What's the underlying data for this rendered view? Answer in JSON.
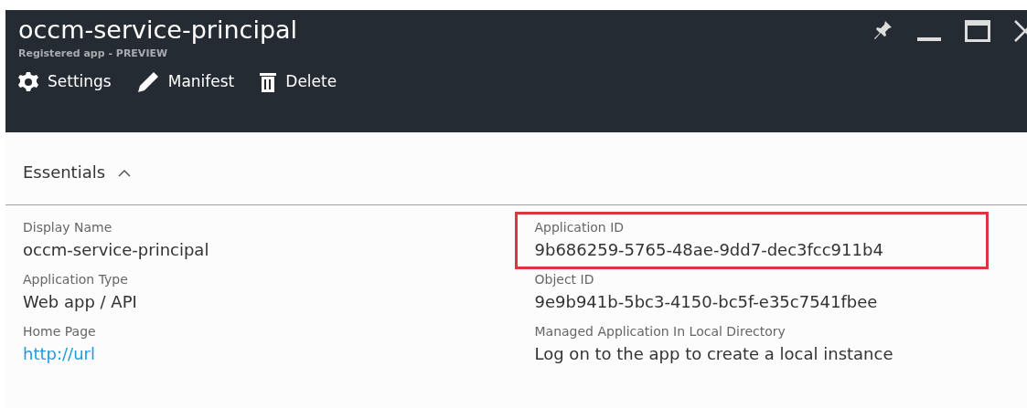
{
  "blade": {
    "title": "occm-service-principal",
    "subtitle": "Registered app - PREVIEW"
  },
  "toolbar": [
    {
      "label": "Settings",
      "kind": "settings"
    },
    {
      "label": "Manifest",
      "kind": "edit"
    },
    {
      "label": "Delete",
      "kind": "delete"
    }
  ],
  "essentials": {
    "title": "Essentials",
    "expanded": true,
    "columns": [
      [
        {
          "label": "Display Name",
          "value": "occm-service-principal",
          "kind": "text",
          "highlighted": false
        },
        {
          "label": "Application Type",
          "value": "Web app / API",
          "kind": "text",
          "highlighted": false
        },
        {
          "label": "Home Page",
          "value": "http://url",
          "kind": "link",
          "highlighted": false
        }
      ],
      [
        {
          "label": "Application ID",
          "value": "9b686259-5765-48ae-9dd7-dec3fcc911b4",
          "kind": "text",
          "highlighted": true
        },
        {
          "label": "Object ID",
          "value": "9e9b941b-5bc3-4150-bc5f-e35c7541fbee",
          "kind": "text",
          "highlighted": false
        },
        {
          "label": "Managed Application In Local Directory",
          "value": "Log on to the app to create a local instance",
          "kind": "text",
          "highlighted": false
        }
      ]
    ]
  }
}
